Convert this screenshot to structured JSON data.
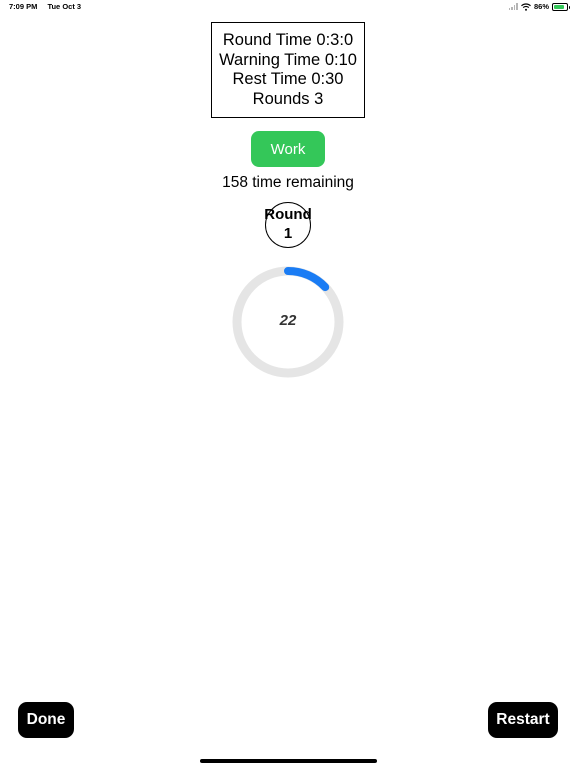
{
  "status_bar": {
    "time": "7:09 PM",
    "date": "Tue Oct 3",
    "battery": "86%",
    "battery_level": 0.86
  },
  "info": {
    "round_time": "Round Time 0:3:0",
    "warning_time": "Warning Time 0:10",
    "rest_time": "Rest Time 0:30",
    "rounds": "Rounds 3"
  },
  "phase_button": {
    "label": "Work",
    "color": "#34c759"
  },
  "time_remaining": "158 time remaining",
  "round": {
    "label": "Round",
    "number": "1"
  },
  "timer": {
    "seconds": "22",
    "progress": 0.13,
    "track_color": "#e5e5e5",
    "progress_color": "#1a7cf4"
  },
  "buttons": {
    "done": "Done",
    "restart": "Restart"
  }
}
